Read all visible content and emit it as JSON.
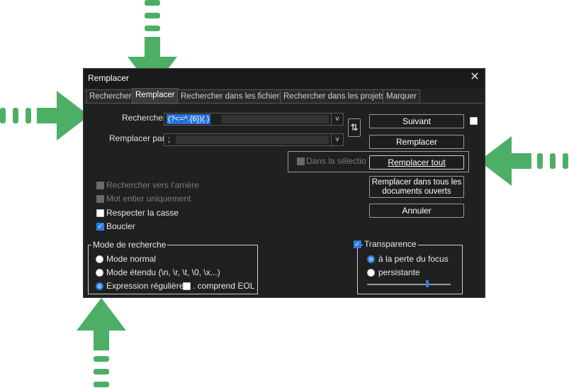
{
  "window": {
    "title": "Remplacer",
    "close_label": "✕"
  },
  "tabs": [
    {
      "label": "Rechercher",
      "active": false
    },
    {
      "label": "Remplacer",
      "active": true
    },
    {
      "label": "Rechercher dans les fichiers",
      "active": false
    },
    {
      "label": "Rechercher dans les projets",
      "active": false
    },
    {
      "label": "Marquer",
      "active": false
    }
  ],
  "fields": {
    "search_label": "Recherche :",
    "search_value": "(?<=^.{6})(.)",
    "replace_label": "Remplacer par :",
    "replace_value": ";",
    "dropdown_glyph": "v",
    "swap_glyph": "⇅"
  },
  "buttons": {
    "next": "Suivant",
    "replace": "Remplacer",
    "replace_all": "Remplacer tout",
    "replace_all_docs": "Remplacer dans tous les documents ouverts",
    "cancel": "Annuler"
  },
  "options": {
    "in_selection": "Dans la sélectio",
    "backward": "Rechercher vers l'arrière",
    "whole_word": "Mot entier uniquement",
    "match_case": "Respecter la casse",
    "wrap": "Boucler"
  },
  "search_mode": {
    "title": "Mode de recherche",
    "normal": "Mode normal",
    "extended": "Mode étendu (\\n, \\r, \\t, \\0, \\x...)",
    "regex": "Expression régulière",
    "dot_newline": ". comprend EOL",
    "selected": "regex"
  },
  "transparency": {
    "title": "Transparence",
    "on_lose_focus": "à la perte du focus",
    "always": "persistante",
    "selected": "on_lose_focus",
    "slider_level": 0.7
  },
  "colors": {
    "arrow": "#4caf65",
    "accent": "#2b7fe0"
  }
}
